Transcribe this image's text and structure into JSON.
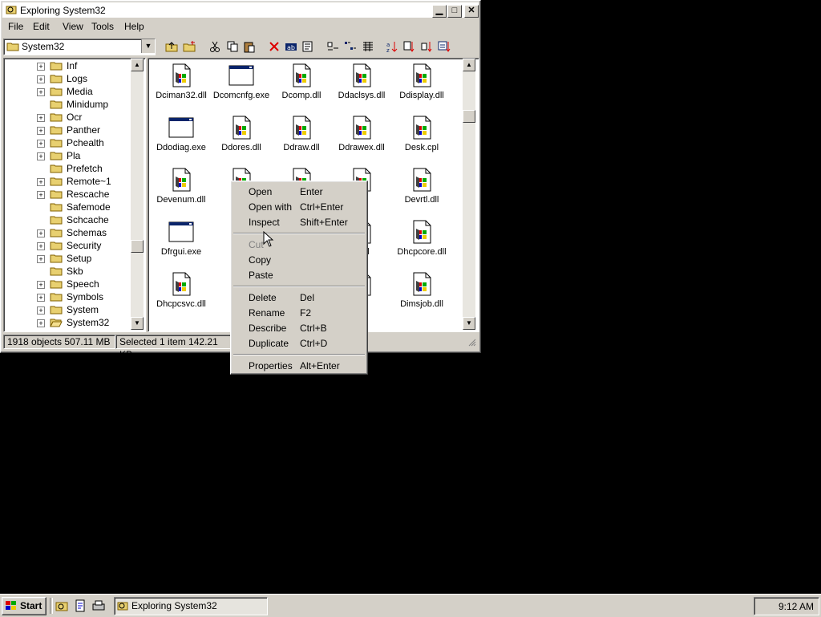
{
  "window": {
    "title": "Exploring System32",
    "minimize": "▁",
    "maximize": "□",
    "close": "✕"
  },
  "menubar": [
    "File",
    "Edit",
    "View",
    "Tools",
    "Help"
  ],
  "address": {
    "value": "System32"
  },
  "tree": {
    "items": [
      {
        "label": "Inf",
        "plus": true
      },
      {
        "label": "Logs",
        "plus": true
      },
      {
        "label": "Media",
        "plus": true
      },
      {
        "label": "Minidump",
        "plus": false
      },
      {
        "label": "Ocr",
        "plus": true
      },
      {
        "label": "Panther",
        "plus": true
      },
      {
        "label": "Pchealth",
        "plus": true
      },
      {
        "label": "Pla",
        "plus": true
      },
      {
        "label": "Prefetch",
        "plus": false
      },
      {
        "label": "Remote~1",
        "plus": true
      },
      {
        "label": "Rescache",
        "plus": true
      },
      {
        "label": "Safemode",
        "plus": false
      },
      {
        "label": "Schcache",
        "plus": false
      },
      {
        "label": "Schemas",
        "plus": true
      },
      {
        "label": "Security",
        "plus": true
      },
      {
        "label": "Setup",
        "plus": true
      },
      {
        "label": "Skb",
        "plus": false
      },
      {
        "label": "Speech",
        "plus": true
      },
      {
        "label": "Symbols",
        "plus": true
      },
      {
        "label": "System",
        "plus": true
      },
      {
        "label": "System32",
        "plus": true,
        "open": true
      }
    ]
  },
  "files": [
    {
      "name": "Dciman32.dll",
      "type": "dll"
    },
    {
      "name": "Dcomcnfg.exe",
      "type": "exe"
    },
    {
      "name": "Dcomp.dll",
      "type": "dll"
    },
    {
      "name": "Ddaclsys.dll",
      "type": "dll"
    },
    {
      "name": "Ddisplay.dll",
      "type": "dll"
    },
    {
      "name": "Ddodiag.exe",
      "type": "exe"
    },
    {
      "name": "Ddores.dll",
      "type": "dll"
    },
    {
      "name": "Ddraw.dll",
      "type": "dll"
    },
    {
      "name": "Ddrawex.dll",
      "type": "dll"
    },
    {
      "name": "Desk.cpl",
      "type": "dll"
    },
    {
      "name": "Devenum.dll",
      "type": "dll"
    },
    {
      "name": "Devi",
      "type": "dll",
      "selected": true
    },
    {
      "name": "",
      "type": "dll"
    },
    {
      "name": "i.dll",
      "type": "dll"
    },
    {
      "name": "Devrtl.dll",
      "type": "dll"
    },
    {
      "name": "Dfrgui.exe",
      "type": "exe"
    },
    {
      "name": "D",
      "type": "dll"
    },
    {
      "name": "",
      "type": "dll"
    },
    {
      "name": "x.dll",
      "type": "dll"
    },
    {
      "name": "Dhcpcore.dll",
      "type": "dll"
    },
    {
      "name": "Dhcpcsvc.dll",
      "type": "dll"
    },
    {
      "name": "Dhc",
      "type": "dll"
    },
    {
      "name": "",
      "type": "dll"
    },
    {
      "name": "i.dll",
      "type": "dll"
    },
    {
      "name": "Dimsjob.dll",
      "type": "dll"
    }
  ],
  "status": {
    "objects": "1918 objects  507.11 MB",
    "selected": "Selected 1 item  142.21 KB"
  },
  "context_menu": [
    {
      "label": "Open",
      "shortcut": "Enter"
    },
    {
      "label": "Open with",
      "shortcut": "Ctrl+Enter"
    },
    {
      "label": "Inspect",
      "shortcut": "Shift+Enter"
    },
    {
      "sep": true
    },
    {
      "label": "Cut",
      "shortcut": "",
      "disabled": true
    },
    {
      "label": "Copy",
      "shortcut": ""
    },
    {
      "label": "Paste",
      "shortcut": ""
    },
    {
      "sep": true
    },
    {
      "label": "Delete",
      "shortcut": "Del"
    },
    {
      "label": "Rename",
      "shortcut": "F2"
    },
    {
      "label": "Describe",
      "shortcut": "Ctrl+B"
    },
    {
      "label": "Duplicate",
      "shortcut": "Ctrl+D"
    },
    {
      "sep": true
    },
    {
      "label": "Properties",
      "shortcut": "Alt+Enter"
    }
  ],
  "taskbar": {
    "start": "Start",
    "task": "Exploring System32",
    "clock": "9:12 AM"
  },
  "colors": {
    "selection": "#0a246a",
    "face": "#d4d0c8",
    "desktop": "#000000"
  }
}
